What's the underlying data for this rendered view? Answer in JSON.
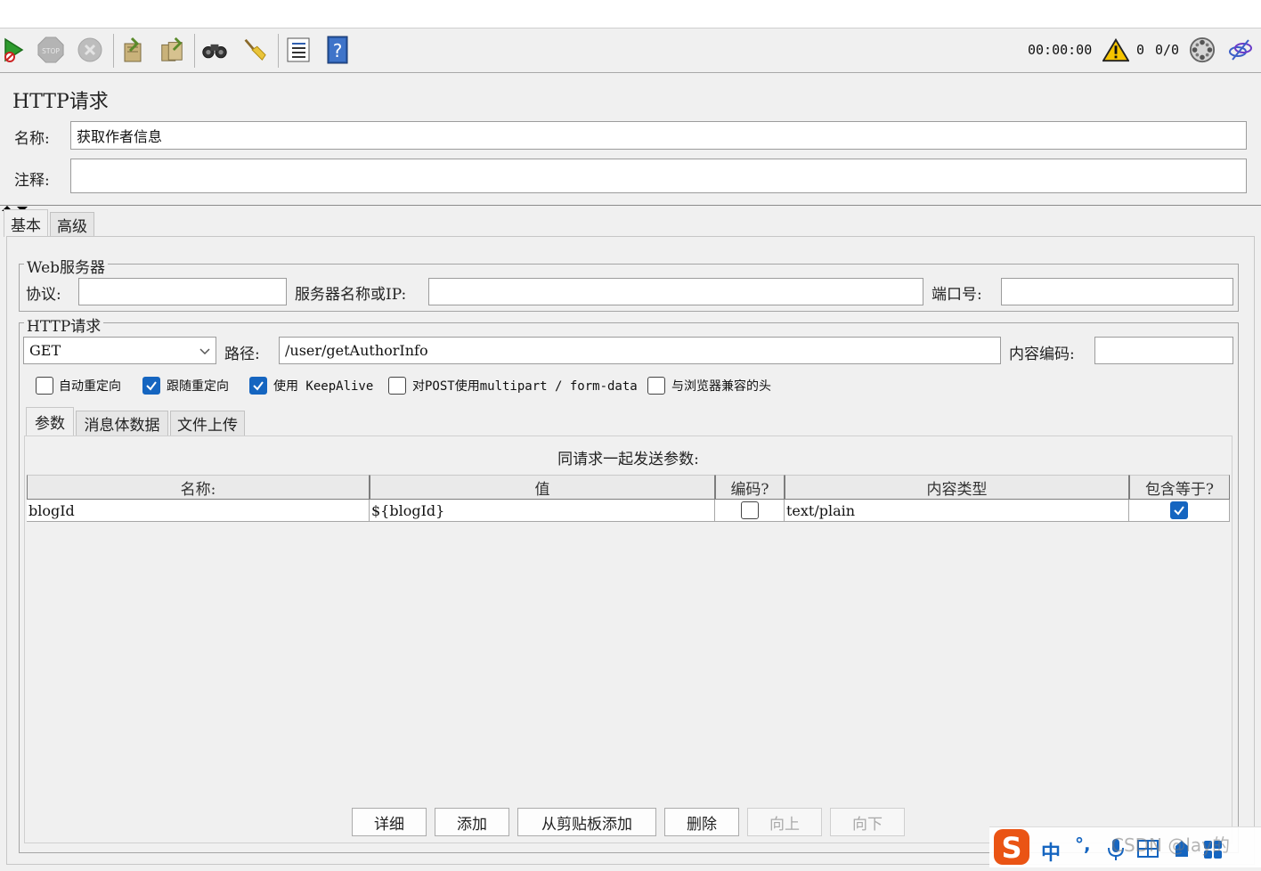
{
  "toolbar": {
    "timer": "00:00:00",
    "warning_count": "0",
    "thread_count": "0/0"
  },
  "sampler": {
    "title": "HTTP请求",
    "name_label": "名称:",
    "name_value": "获取作者信息",
    "comment_label": "注释:",
    "comment_value": ""
  },
  "tabs": [
    {
      "label": "基本",
      "active": true
    },
    {
      "label": "高级",
      "active": false
    }
  ],
  "web_server": {
    "legend": "Web服务器",
    "protocol_label": "协议:",
    "protocol_value": "",
    "server_label": "服务器名称或IP:",
    "server_value": "",
    "port_label": "端口号:",
    "port_value": ""
  },
  "http_request": {
    "legend": "HTTP请求",
    "method": "GET",
    "path_label": "路径:",
    "path_value": "/user/getAuthorInfo",
    "encoding_label": "内容编码:",
    "encoding_value": "",
    "options": [
      {
        "label": "自动重定向",
        "checked": false
      },
      {
        "label": "跟随重定向",
        "checked": true
      },
      {
        "label": "使用 KeepAlive",
        "checked": true
      },
      {
        "label": "对POST使用multipart / form-data",
        "checked": false
      },
      {
        "label": "与浏览器兼容的头",
        "checked": false
      }
    ]
  },
  "sub_tabs": [
    {
      "label": "参数",
      "active": true
    },
    {
      "label": "消息体数据",
      "active": false
    },
    {
      "label": "文件上传",
      "active": false
    }
  ],
  "params": {
    "caption": "同请求一起发送参数:",
    "columns": [
      "名称:",
      "值",
      "编码?",
      "内容类型",
      "包含等于?"
    ],
    "rows": [
      {
        "name": "blogId",
        "value": "${blogId}",
        "encode": false,
        "content_type": "text/plain",
        "include_equals": true
      }
    ]
  },
  "buttons": [
    {
      "label": "详细",
      "enabled": true
    },
    {
      "label": "添加",
      "enabled": true
    },
    {
      "label": "从剪贴板添加",
      "enabled": true
    },
    {
      "label": "删除",
      "enabled": true
    },
    {
      "label": "向上",
      "enabled": false
    },
    {
      "label": "向下",
      "enabled": false
    }
  ],
  "ime": {
    "mode": "中",
    "punct": "°,",
    "watermark": "CSDN @lay的"
  },
  "colors": {
    "accent": "#1565c0",
    "ime_brand": "#ea5414",
    "warning": "#f5c400"
  }
}
